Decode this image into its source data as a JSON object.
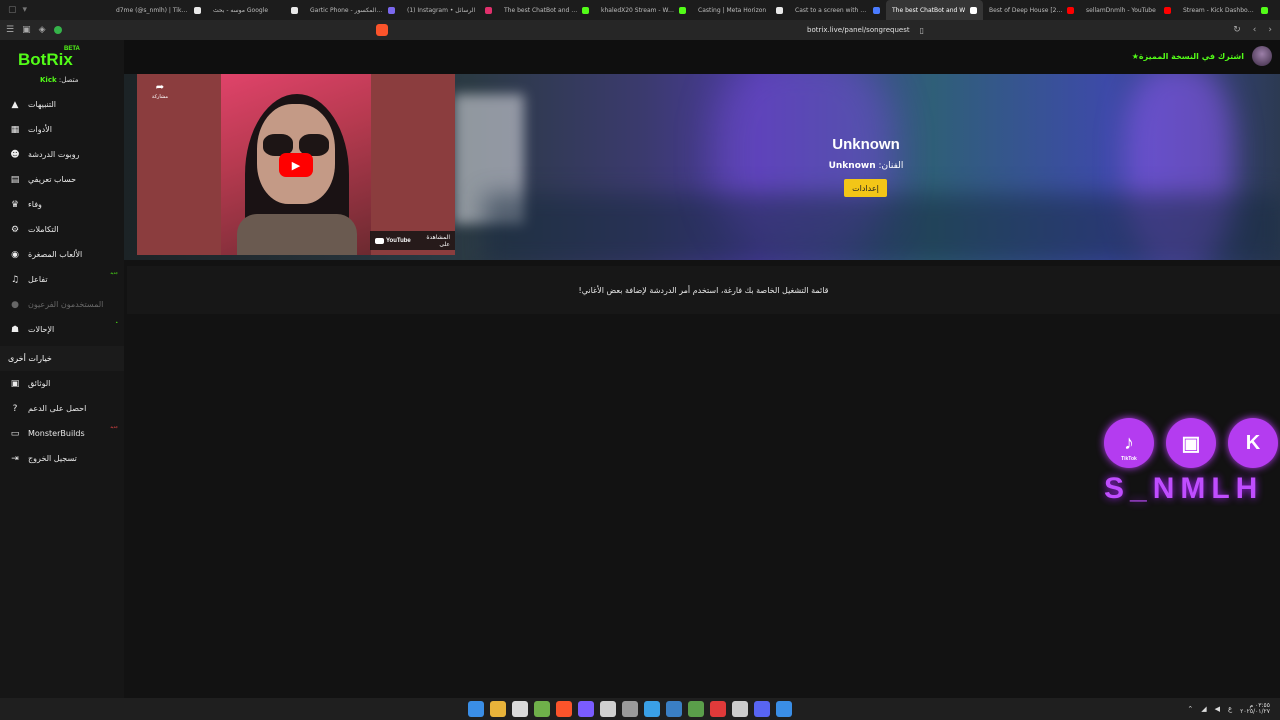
{
  "browser": {
    "tabs": [
      {
        "label": "d7me (@s_nmlh) | TikTok(5)",
        "color": "#e8e8e8",
        "active": false
      },
      {
        "label": "موسه - بحث Google",
        "color": "#e8e8e8",
        "active": false
      },
      {
        "label": "Gartic Phone - الهاتف المكسور",
        "color": "#7b68ee",
        "active": false
      },
      {
        "label": "(1) Instagram • الرسائل",
        "color": "#e1306c",
        "active": false
      },
      {
        "label": "The best ChatBot and Widg",
        "color": "#53fc18",
        "active": false
      },
      {
        "label": "khaledX20 Stream - Watch",
        "color": "#53fc18",
        "active": false
      },
      {
        "label": "Casting | Meta Horizon",
        "color": "#e8e8e8",
        "active": false
      },
      {
        "label": "Cast to a screen with Meta",
        "color": "#4a7bff",
        "active": false
      },
      {
        "label": "The best ChatBot and W",
        "color": "#ffffff",
        "active": true
      },
      {
        "label": "Best of Deep House [2025]",
        "color": "#ff0000",
        "active": false
      },
      {
        "label": "sellamDnmlh - YouTube",
        "color": "#ff0000",
        "active": false
      },
      {
        "label": "Stream - Kick Dashboard",
        "color": "#53fc18",
        "active": false
      }
    ],
    "url": "botrix.live/panel/songrequest"
  },
  "sidebar": {
    "logo": "BotRix",
    "beta": "BETA",
    "connected_prefix": "متصل:",
    "connected_platform": "Kick",
    "items": [
      {
        "label": "التنبيهات",
        "icon": "warning-icon",
        "glyph": "▲",
        "disabled": false,
        "badge": ""
      },
      {
        "label": "الأدوات",
        "icon": "tools-icon",
        "glyph": "▦",
        "disabled": false,
        "badge": ""
      },
      {
        "label": "روبوت الدردشة",
        "icon": "robot-icon",
        "glyph": "☻",
        "disabled": false,
        "badge": ""
      },
      {
        "label": "حساب تعريفي",
        "icon": "profile-card-icon",
        "glyph": "▤",
        "disabled": false,
        "badge": ""
      },
      {
        "label": "وفاء",
        "icon": "trophy-icon",
        "glyph": "♛",
        "disabled": false,
        "badge": ""
      },
      {
        "label": "التكاملات",
        "icon": "integrations-icon",
        "glyph": "⚙",
        "disabled": false,
        "badge": ""
      },
      {
        "label": "الألعاب المصغرة",
        "icon": "gamepad-icon",
        "glyph": "◉",
        "disabled": false,
        "badge": ""
      },
      {
        "label": "تفاعل",
        "icon": "music-icon",
        "glyph": "♫",
        "disabled": false,
        "badge": "جديد"
      },
      {
        "label": "المستخدمون الفرعيون",
        "icon": "users-icon",
        "glyph": "●",
        "disabled": true,
        "badge": ""
      },
      {
        "label": "الإحالات",
        "icon": "referrals-icon",
        "glyph": "☗",
        "disabled": false,
        "badge": "•"
      }
    ],
    "section_label": "خيارات أخرى",
    "other_items": [
      {
        "label": "الوثائق",
        "icon": "docs-icon",
        "glyph": "▣",
        "badge": ""
      },
      {
        "label": "احصل على الدعم",
        "icon": "help-icon",
        "glyph": "?",
        "badge": ""
      },
      {
        "label": "MonsterBuilds",
        "icon": "monitor-icon",
        "glyph": "▭",
        "badge": "جديد"
      },
      {
        "label": "تسجيل الخروج",
        "icon": "logout-icon",
        "glyph": "⇥",
        "badge": ""
      }
    ]
  },
  "header": {
    "premium_label": "اشترك في النسخة المميزة"
  },
  "player": {
    "share_label": "مشاركة",
    "watch_on_label": "المشاهدة على",
    "youtube_label": "YouTube",
    "song_title": "Unknown",
    "artist_prefix": "الفنان:",
    "artist_name": "Unknown",
    "settings_label": "إعدادات"
  },
  "playlist": {
    "empty_message": "قائمة التشغيل الخاصة بك فارغة، استخدم أمر الدردشة لإضافة بعض الأغاني!"
  },
  "overlay": {
    "socials": [
      {
        "name": "tiktok-logo",
        "glyph": "♪",
        "sub": "TikTok"
      },
      {
        "name": "twitch-logo",
        "glyph": "▣",
        "sub": ""
      },
      {
        "name": "kick-logo",
        "glyph": "K",
        "sub": ""
      }
    ],
    "username": "S_NMLH"
  },
  "taskbar": {
    "icon_colors": [
      "#3a8ee6",
      "#e8b33a",
      "#d9d9d9",
      "#6fb04a",
      "#fb542b",
      "#7a5cff",
      "#d0d0d0",
      "#9a9a9a",
      "#3aa0e6",
      "#3a7fc4",
      "#5a9e4a",
      "#e03a3a",
      "#cccccc",
      "#5865f2",
      "#3a8ee6"
    ],
    "lang": "ع",
    "time": "٠٣:٥٥ م",
    "date": "٢٠٢٥/٠١/٢٧"
  }
}
